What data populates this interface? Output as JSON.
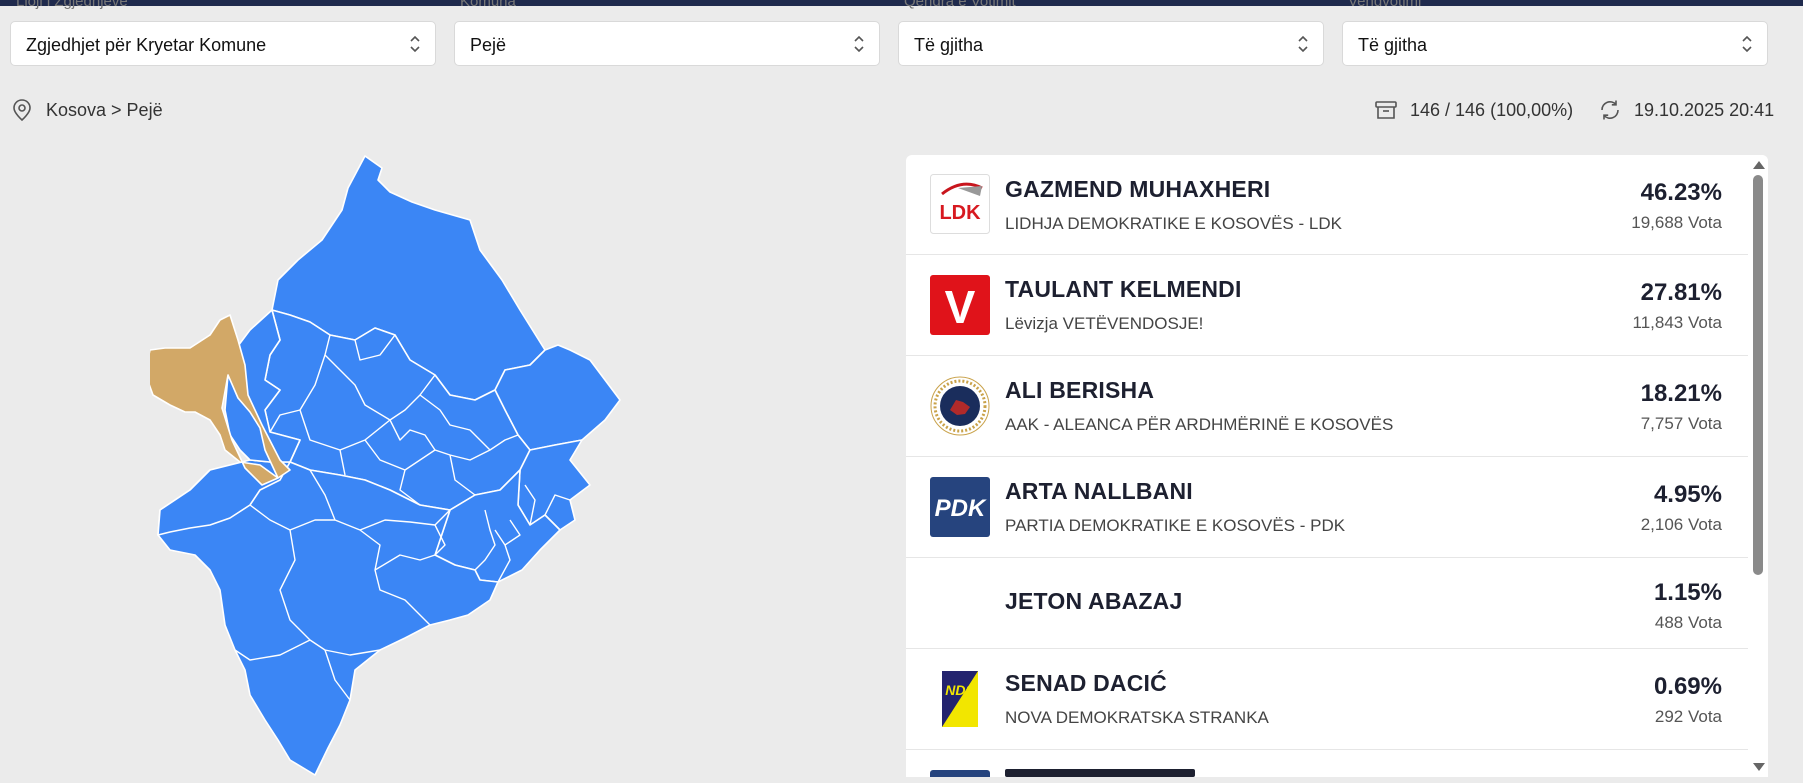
{
  "filters": [
    {
      "label": "Lloji i Zgjedhjeve",
      "value": "Zgjedhjet për Kryetar Komune"
    },
    {
      "label": "Komuna",
      "value": "Pejë"
    },
    {
      "label": "Qendra e Votimit",
      "value": "Të gjitha"
    },
    {
      "label": "Vendvotimi",
      "value": "Të gjitha"
    }
  ],
  "breadcrumb": "Kosova > Pejë",
  "stations": "146 / 146 (100,00%)",
  "updated": "19.10.2025 20:41",
  "icons": {
    "location": "map-pin-icon",
    "stations": "archive-box-icon",
    "refresh": "refresh-icon",
    "select": "chevron-up-down-icon"
  },
  "colors": {
    "map_region": "#3b86f5",
    "selected_region": "#d2a867",
    "topbar": "#1f2a4d"
  },
  "map": {
    "selected": "Pejë"
  },
  "candidates": [
    {
      "name": "GAZMEND MUHAXHERI",
      "party": "LIDHJA DEMOKRATIKE E KOSOVËS - LDK",
      "percent": "46.23%",
      "votes": "19,688 Vota",
      "logo": "ldk-logo",
      "logo_text": "LDK"
    },
    {
      "name": "TAULANT KELMENDI",
      "party": "Lëvizja VETËVENDOSJE!",
      "percent": "27.81%",
      "votes": "11,843 Vota",
      "logo": "vetevendosje-logo",
      "logo_text": "V"
    },
    {
      "name": "ALI BERISHA",
      "party": "AAK - ALEANCA PËR ARDHMËRINË E KOSOVËS",
      "percent": "18.21%",
      "votes": "7,757 Vota",
      "logo": "aak-logo"
    },
    {
      "name": "ARTA NALLBANI",
      "party": "PARTIA DEMOKRATIKE E KOSOVËS - PDK",
      "percent": "4.95%",
      "votes": "2,106 Vota",
      "logo": "pdk-logo",
      "logo_text": "PDK"
    },
    {
      "name": "JETON ABAZAJ",
      "party": "",
      "percent": "1.15%",
      "votes": "488 Vota"
    },
    {
      "name": "SENAD DACIĆ",
      "party": "NOVA DEMOKRATSKA STRANKA",
      "percent": "0.69%",
      "votes": "292 Vota",
      "logo": "nds-logo",
      "logo_text": "NDS"
    }
  ]
}
